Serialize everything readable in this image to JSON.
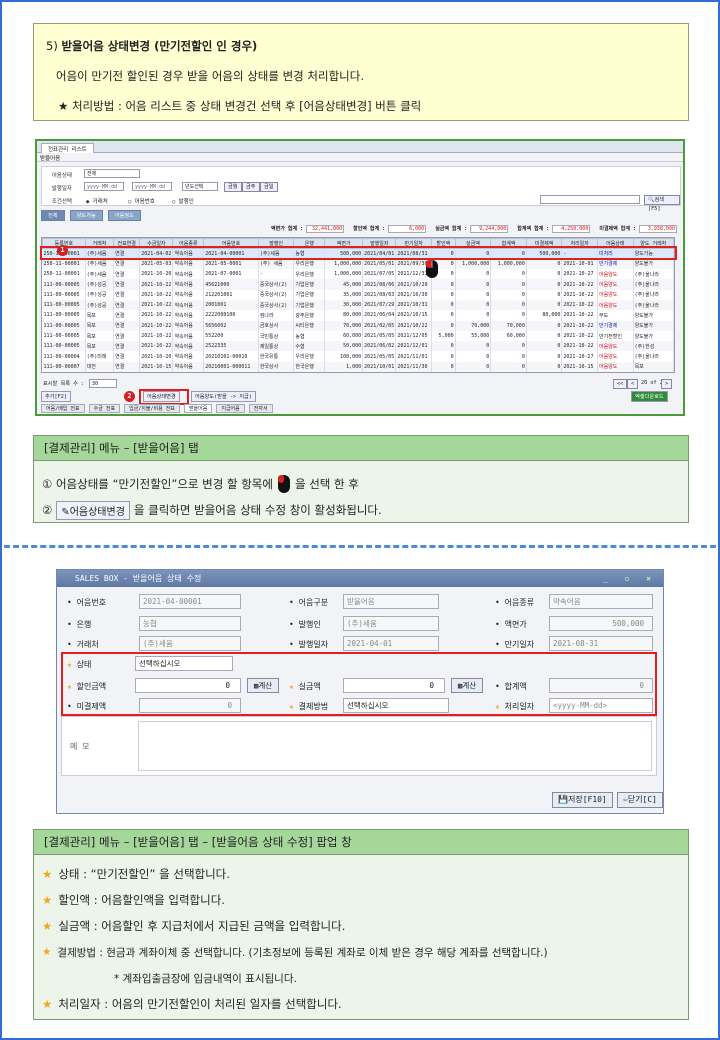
{
  "note": {
    "title_num": "5) ",
    "title": "받을어음 상태변경 (만기전할인 인 경우)",
    "desc": "어음이 만기전 할인된 경우 받을 어음의 상태를 변경 처리합니다.",
    "method": "★ 처리방법 : 어음 리스트 중 상태 변경건 선택 후 [어음상태변경] 버튼 클릭"
  },
  "app": {
    "tab": "전표관리 리스트",
    "subtitle": "받을어음",
    "search": {
      "label_status": "어음상태",
      "status_value": "전체",
      "label_date": "발행일자",
      "date_from": "yyyy-MM-dd",
      "date_to": "yyyy-MM-dd",
      "year_select": "년도선택",
      "btn_month": "금월",
      "btn_prev": "금주",
      "btn_day": "금일",
      "label_cond": "조건선택",
      "cond1": "거래처",
      "cond2": "어음번호",
      "cond3": "발행인",
      "btn_search": "검색[F5]",
      "btn_reset": "리셋"
    },
    "toolbar2": [
      "전체",
      "양도가능",
      "어음정도"
    ],
    "summary": [
      {
        "label": "액면가 합계 :",
        "value": "32,441,000"
      },
      {
        "label": "할인액 합계 :",
        "value": "6,000"
      },
      {
        "label": "실금액 합계 :",
        "value": "9,244,000"
      },
      {
        "label": "합계액 합계 :",
        "value": "4,250,000"
      },
      {
        "label": "미결제액 합계 :",
        "value": "3,938,000"
      }
    ],
    "columns": [
      "등록번호",
      "거래처",
      "전표연결",
      "수금일자",
      "어음종류",
      "어음번호",
      "발행인",
      "은행",
      "액면가",
      "발행일자",
      "만기일자",
      "할인액",
      "실금액",
      "합계액",
      "미결제액",
      "처리일자",
      "어음상태",
      "양도 거래처",
      "어음일요일"
    ],
    "rows": [
      [
        "250-11-00001",
        "(주)세움",
        "연결",
        "2021-04-02",
        "약속어음",
        "2021-04-00001",
        "(주)세움",
        "농협",
        "500,000",
        "2021/04/01",
        "2021/08/31",
        "0",
        "0",
        "0",
        "500,000",
        "-",
        "미처리",
        "양도가능"
      ],
      [
        "250-11-00001",
        "(주)세움",
        "연결",
        "2021-05-03",
        "약속어음",
        "2021-05-0001",
        "(주) 세움",
        "우리은행",
        "1,000,000",
        "2021/05/01",
        "2021/09/30",
        "0",
        "1,000,000",
        "1,000,000",
        "0",
        "2021-10-01",
        "만기결제",
        "양도불가"
      ],
      [
        "250-11-00001",
        "(주)세움",
        "연결",
        "2021-10-20",
        "약속어음",
        "2021-07-0001",
        "-",
        "우리은행",
        "1,000,000",
        "2021/07/05",
        "2021/12/31",
        "0",
        "0",
        "0",
        "0",
        "2021-10-27",
        "어음양도",
        "(주)울나라"
      ],
      [
        "111-00-00005",
        "(주)성공",
        "연결",
        "2021-10-22",
        "약속어음",
        "45621000",
        "중국상사(2)",
        "기업은행",
        "45,000",
        "2021/08/06",
        "2021/10/29",
        "0",
        "0",
        "0",
        "0",
        "2021-10-22",
        "어음양도",
        "(주)울나라"
      ],
      [
        "111-00-00005",
        "(주)성공",
        "연결",
        "2021-10-22",
        "약속어음",
        "212201001",
        "중국상사(2)",
        "기업은행",
        "35,000",
        "2021/08/03",
        "2021/10/30",
        "0",
        "0",
        "0",
        "0",
        "2021-10-22",
        "어음양도",
        "(주)울나라"
      ],
      [
        "111-00-00005",
        "(주)성공",
        "연결",
        "2021-10-22",
        "약속어음",
        "2001001",
        "중국상사(2)",
        "기업은행",
        "30,000",
        "2021/07/29",
        "2021/10/31",
        "0",
        "0",
        "0",
        "0",
        "2021-10-22",
        "어음양도",
        "(주)울나라"
      ],
      [
        "111-00-00005",
        "목포",
        "연결",
        "2021-10-22",
        "약속어음",
        "2222000100",
        "컴나라",
        "광주은행",
        "80,000",
        "2021/06/04",
        "2021/10/15",
        "0",
        "0",
        "0",
        "80,000",
        "2021-10-22",
        "부도",
        "양도불가"
      ],
      [
        "111-00-00005",
        "목포",
        "연결",
        "2021-10-22",
        "약속어음",
        "5656002",
        "금호상사",
        "씨티은행",
        "70,000",
        "2021/02/05",
        "2021/10/22",
        "0",
        "70,000",
        "70,000",
        "0",
        "2021-10-22",
        "만기결제",
        "양도불가"
      ],
      [
        "111-00-00005",
        "목포",
        "연결",
        "2021-10-22",
        "약속어음",
        "552200",
        "국민통상",
        "농협",
        "60,000",
        "2021/05/05",
        "2021/12/05",
        "5,000",
        "55,000",
        "60,000",
        "0",
        "2021-10-22",
        "만기전할인",
        "양도불가"
      ],
      [
        "111-00-00005",
        "목포",
        "연결",
        "2021-10-22",
        "약속어음",
        "2522335",
        "제일통상",
        "수협",
        "50,000",
        "2021/06/02",
        "2021/12/01",
        "0",
        "0",
        "0",
        "0",
        "2021-10-22",
        "어음양도",
        "(주)한성"
      ],
      [
        "111-00-00004",
        "(주)미래",
        "연결",
        "2021-10-20",
        "약속어음",
        "20210101-00010",
        "한국유통",
        "우리은행",
        "100,000",
        "2021/05/05",
        "2021/11/01",
        "0",
        "0",
        "0",
        "0",
        "2021-10-27",
        "어음양도",
        "(주)울나라"
      ],
      [
        "111-00-00007",
        "대전",
        "연결",
        "2021-10-15",
        "약속어음",
        "20210001-000011",
        "한국상사",
        "한국은행",
        "1,000",
        "2021/10/01",
        "2021/11/30",
        "0",
        "0",
        "0",
        "0",
        "2021-10-15",
        "어음양도",
        "목포"
      ]
    ],
    "pager": {
      "label": "표시할 목록 수 :",
      "count": "30",
      "info": "20 of 20"
    },
    "bottom_buttons": {
      "add": "추가[F2]",
      "change_status": "어음상태변경",
      "transfer": "어음양도(받을 -> 지급)",
      "excel": "엑셀다운로드"
    },
    "bottom_tabs": [
      "어음/배입 전표",
      "수금 전표",
      "입금/지불/비용 전표",
      "받을어음",
      "지급어음",
      "전자서"
    ]
  },
  "box1": {
    "header": "[결제관리] 메뉴 – [받을어음] 탭",
    "line1_a": "①  어음상태를 “만기전할인”으로 변경 할 항목에",
    "line1_b": "을  선택 한 후",
    "line2_a": "②",
    "line2_btn": "어음상태변경",
    "line2_b": "을 클릭하면 받을어음 상태 수정 창이 활성화됩니다."
  },
  "popup": {
    "title": "SALES BOX - 받을어음 상태 수정",
    "f_no_label": "어음번호",
    "f_no": "2021-04-00001",
    "f_kind_label": "어음구분",
    "f_kind": "받을어음",
    "f_type_label": "어음종류",
    "f_type": "약속어음",
    "f_bank_label": "은행",
    "f_bank": "농협",
    "f_issuer_label": "발행인",
    "f_issuer": "(주)세움",
    "f_face_label": "액면가",
    "f_face": "500,000",
    "f_client_label": "거래처",
    "f_client": "(주)세움",
    "f_issue_label": "발행일자",
    "f_issue": "2021-04-01",
    "f_due_label": "만기일자",
    "f_due": "2021-08-31",
    "f_status_label": "상태",
    "f_status": "선택하십시오",
    "f_disc_label": "할인금액",
    "f_disc": "0",
    "f_calc": "계산",
    "f_real_label": "실금액",
    "f_real": "0",
    "f_sum_label": "합계액",
    "f_sum": "0",
    "f_unpaid_label": "미결제액",
    "f_unpaid": "0",
    "f_method_label": "결제방법",
    "f_method": "선택하십시오",
    "f_pdate_label": "처리일자",
    "f_pdate": "<yyyy-MM-dd>",
    "f_memo_label": "메 모",
    "btn_save": "저장[F10]",
    "btn_close": "닫기[C]"
  },
  "box2": {
    "header": "[결제관리] 메뉴 – [받을어음] 탭 – [받을어음 상태 수정] 팝업 창",
    "l1": "상태 :  “만기전할인” 을 선택합니다.",
    "l2": "할인액 : 어음할인액을 입력합니다.",
    "l3": "실금액 : 어음할인 후 지급처에서 지급된 금액을 입력합니다.",
    "l4": "결제방법 : 현금과 계좌이체 중 선택합니다. (기초정보에 등록된 계좌로 이체 받은 경우 해당 계좌를 선택합니다.)",
    "l5": "* 계좌입출금장에 입금내역이 표시됩니다.",
    "l6": "처리일자 : 어음의 만기전할인이 처리된 일자를 선택합니다."
  }
}
